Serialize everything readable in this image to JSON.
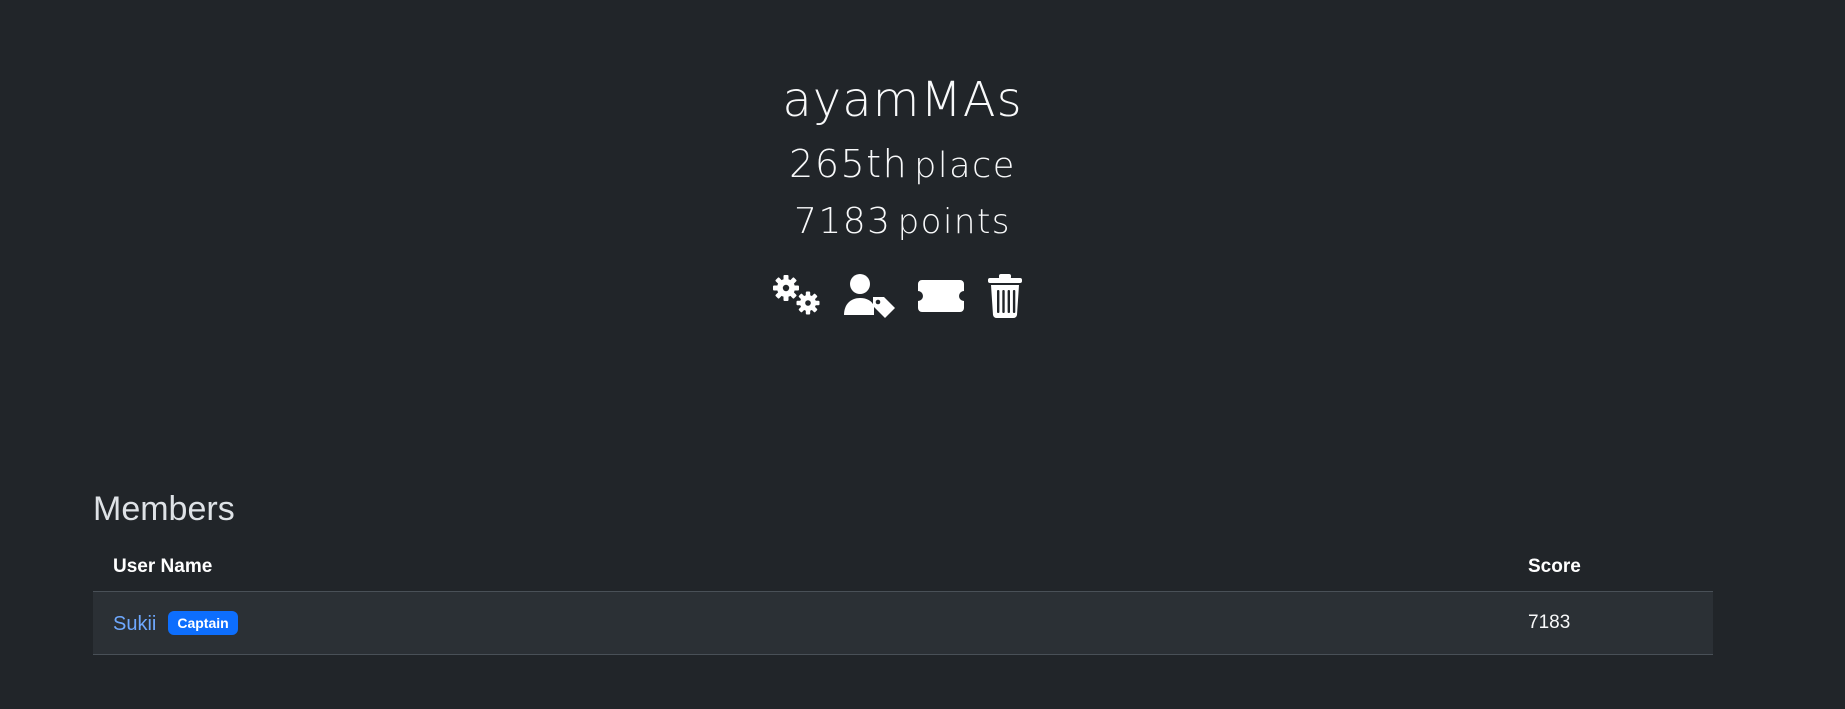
{
  "team": {
    "name": "ayamMAs",
    "place_number": "265th",
    "place_word": "place",
    "points_number": "7183",
    "points_word": "points"
  },
  "actions": [
    {
      "icon": "gears-icon",
      "label": "Settings"
    },
    {
      "icon": "user-tag-icon",
      "label": "Captain"
    },
    {
      "icon": "ticket-icon",
      "label": "Invite"
    },
    {
      "icon": "trash-icon",
      "label": "Disband"
    }
  ],
  "members": {
    "title": "Members",
    "columns": [
      "User Name",
      "Score"
    ],
    "rows": [
      {
        "user": "Sukii",
        "badge": "Captain",
        "score": "7183"
      }
    ]
  },
  "colors": {
    "background": "#212529",
    "link": "#6ea8fe",
    "badge": "#0d6efd"
  }
}
